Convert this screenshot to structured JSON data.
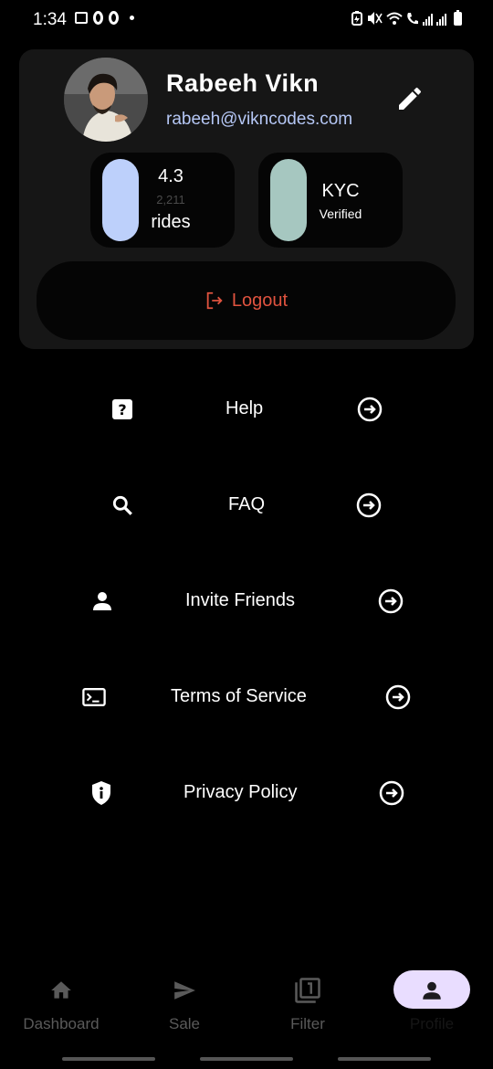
{
  "status_bar": {
    "time": "1:34"
  },
  "profile": {
    "name": "Rabeeh Vikn",
    "email": "rabeeh@vikncodes.com",
    "rating": "4.3",
    "rides_count": "2,211",
    "rides_label": "rides",
    "kyc_title": "KYC",
    "kyc_status": "Verified",
    "logout_label": "Logout"
  },
  "menu": [
    {
      "label": "Help",
      "icon": "help-icon"
    },
    {
      "label": "FAQ",
      "icon": "search-icon"
    },
    {
      "label": "Invite Friends",
      "icon": "person-icon"
    },
    {
      "label": "Terms of Service",
      "icon": "terminal-icon"
    },
    {
      "label": "Privacy Policy",
      "icon": "shield-info-icon"
    }
  ],
  "nav": [
    {
      "label": "Dashboard",
      "icon": "home-icon"
    },
    {
      "label": "Sale",
      "icon": "send-icon"
    },
    {
      "label": "Filter",
      "icon": "filter-1-icon"
    },
    {
      "label": "Profile",
      "icon": "person-icon",
      "active": true
    }
  ],
  "colors": {
    "background": "#000000",
    "card": "#161616",
    "email": "#b5c7f5",
    "logout": "#e0533f",
    "rides_pill": "#bdd0fb",
    "kyc_pill": "#a6c7c0",
    "nav_active": "#e9ddff"
  }
}
